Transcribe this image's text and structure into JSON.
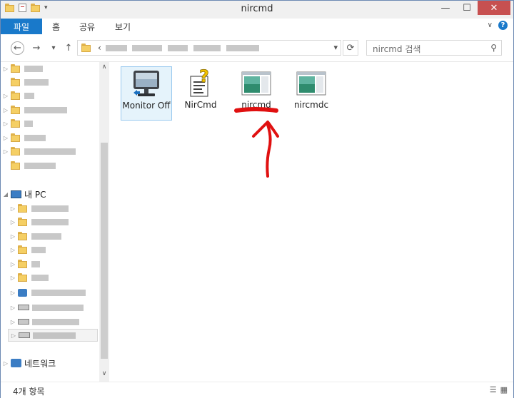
{
  "window": {
    "title": "nircmd",
    "controls": {
      "minimize": "—",
      "maximize": "☐",
      "close": "✕"
    }
  },
  "ribbon": {
    "file_tab": "파일",
    "tabs": [
      "홈",
      "공유",
      "보기"
    ]
  },
  "address": {
    "back_icon": "←",
    "forward_icon": "→",
    "recent_icon": "▾",
    "up_icon": "↑",
    "path_prefix": "‹",
    "refresh_icon": "⟳",
    "search_placeholder": "nircmd 검색"
  },
  "sidebar": {
    "this_pc": "내 PC",
    "network": "네트워크"
  },
  "files": [
    {
      "name": "Monitor Off",
      "icon": "monitor-icon",
      "selected": true
    },
    {
      "name": "NirCmd",
      "icon": "script-icon"
    },
    {
      "name": "nircmd",
      "icon": "application-icon"
    },
    {
      "name": "nircmdc",
      "icon": "application-icon"
    }
  ],
  "annotation": {
    "color": "#e01010"
  },
  "status": {
    "item_count": "4개 항목"
  },
  "colors": {
    "accent": "#1979ca",
    "selection": "#e5f3fb",
    "folder": "#f5cf64"
  }
}
